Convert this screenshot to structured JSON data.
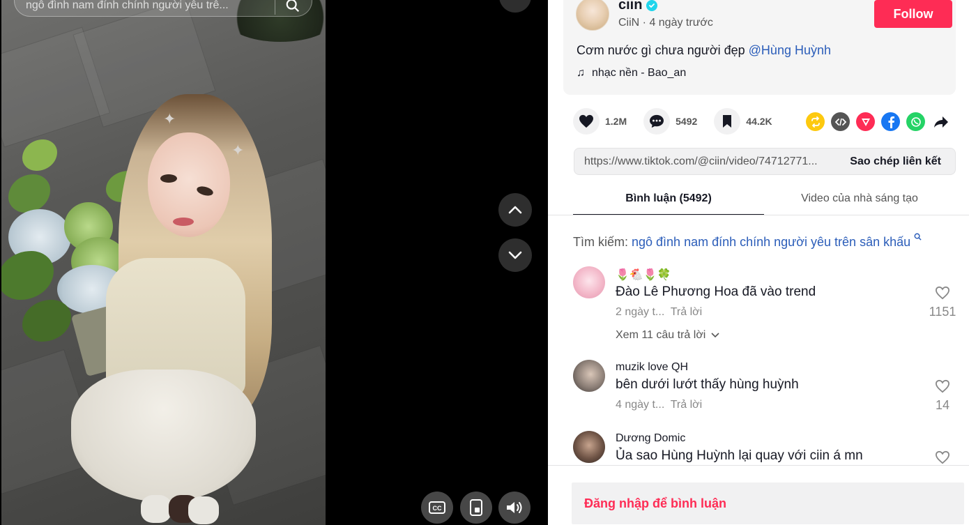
{
  "video": {
    "search_text": "ngô đình nam đính chính người yêu trê..."
  },
  "author": {
    "username": "ciin",
    "nickname": "CiiN",
    "separator": " · ",
    "posted": "4 ngày trước",
    "follow_label": "Follow"
  },
  "caption": {
    "text": "Cơm nước gì chưa người đẹp ",
    "mention": "@Hùng Huỳnh",
    "music": "nhạc nền - Bao_an"
  },
  "stats": {
    "likes": "1.2M",
    "comments": "5492",
    "saves": "44.2K"
  },
  "share": {
    "link": "https://www.tiktok.com/@ciin/video/74712771...",
    "copy_label": "Sao chép liên kết",
    "icons": [
      "repost-icon",
      "embed-icon",
      "send-icon",
      "facebook-icon",
      "whatsapp-icon",
      "share-arrow-icon"
    ]
  },
  "tabs": [
    {
      "label": "Bình luận (5492)",
      "active": true
    },
    {
      "label": "Video của nhà sáng tạo",
      "active": false
    }
  ],
  "search_suggest": {
    "label": "Tìm kiếm: ",
    "query": "ngô đình nam đính chính người yêu trên sân khấu"
  },
  "comments": [
    {
      "username": "🌷🐔🌷🍀",
      "text": "Đào Lê Phương Hoa đã vào trend",
      "date": "2 ngày t...",
      "reply": "Trả lời",
      "likes": "1151",
      "view_replies": "Xem 11 câu trả lời"
    },
    {
      "username": "muzik love QH",
      "text": "bên dưới lướt thấy hùng huỳnh",
      "date": "4 ngày t...",
      "reply": "Trả lời",
      "likes": "14"
    },
    {
      "username": "Dương Domic",
      "text": "Ủa sao Hùng Huỳnh lại quay với ciin á mn"
    }
  ],
  "login_prompt": "Đăng nhập để bình luận",
  "colors": {
    "accent": "#fe2c55",
    "mention": "#2b5db9",
    "verified": "#20d5ec"
  }
}
